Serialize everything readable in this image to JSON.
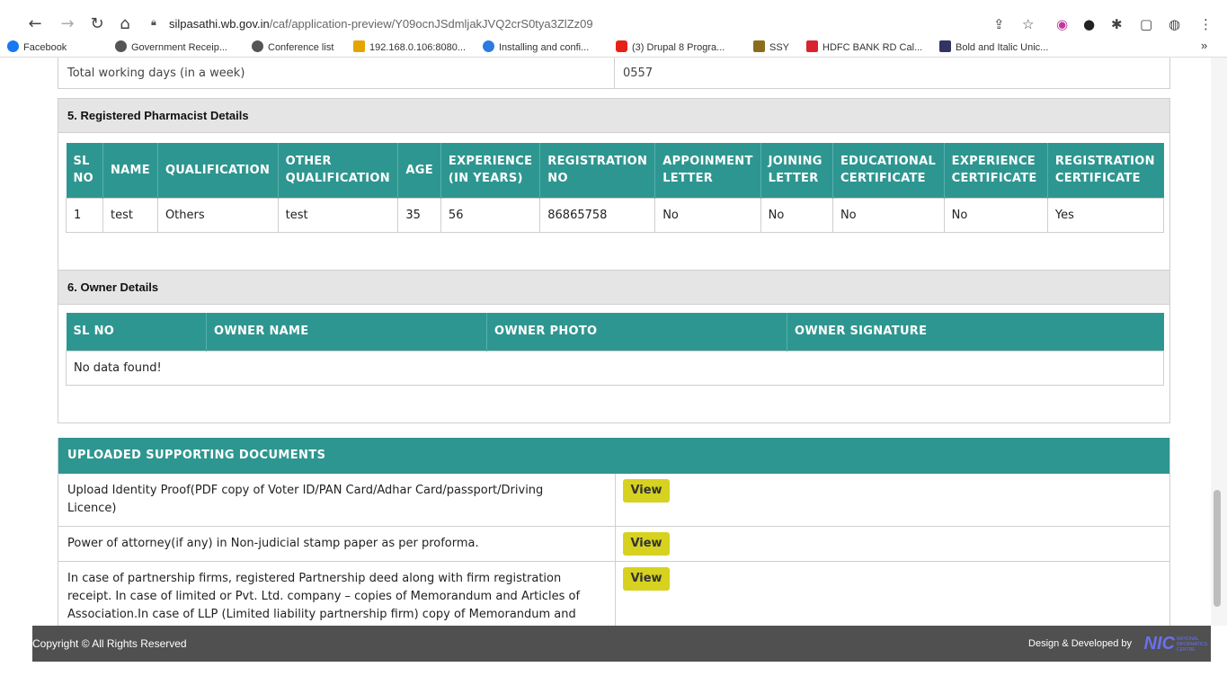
{
  "browser": {
    "url_host": "silpasathi.wb.gov.in",
    "url_path": "/caf/application-preview/Y09ocnJSdmljakJVQ2crS0tya3ZlZz09",
    "bookmarks": [
      {
        "label": "Facebook",
        "color": "#1877f2"
      },
      {
        "label": "Government Receip...",
        "color": "#555555"
      },
      {
        "label": "Conference list",
        "color": "#555555"
      },
      {
        "label": "192.168.0.106:8080...",
        "color": "#e6a400"
      },
      {
        "label": "Installing and confi...",
        "color": "#2a7ae2"
      },
      {
        "label": "(3) Drupal 8 Progra...",
        "color": "#e62117"
      },
      {
        "label": "SSY",
        "color": "#8a6d1b"
      },
      {
        "label": "HDFC BANK RD Cal...",
        "color": "#d9232e"
      },
      {
        "label": "Bold and Italic Unic...",
        "color": "#333366"
      }
    ],
    "more": "»"
  },
  "prev_row": {
    "label": "Total working days (in a week)",
    "value": "0557"
  },
  "pharmacist": {
    "title": "5. Registered Pharmacist Details",
    "headers": [
      "SL NO",
      "NAME",
      "QUALIFICATION",
      "OTHER QUALIFICATION",
      "AGE",
      "EXPERIENCE (IN YEARS)",
      "REGISTRATION NO",
      "APPOINMENT LETTER",
      "JOINING LETTER",
      "EDUCATIONAL CERTIFICATE",
      "EXPERIENCE CERTIFICATE",
      "REGISTRATION CERTIFICATE"
    ],
    "rows": [
      [
        "1",
        "test",
        "Others",
        "test",
        "35",
        "56",
        "86865758",
        "No",
        "No",
        "No",
        "No",
        "Yes"
      ]
    ]
  },
  "owner": {
    "title": "6. Owner Details",
    "headers": [
      "SL NO",
      "OWNER NAME",
      "OWNER PHOTO",
      "OWNER SIGNATURE"
    ],
    "empty": "No data found!"
  },
  "docs": {
    "title": "UPLOADED SUPPORTING DOCUMENTS",
    "items": [
      {
        "text": "Upload Identity Proof(PDF copy of Voter ID/PAN Card/Adhar Card/passport/Driving Licence)",
        "button": "View"
      },
      {
        "text": "Power of attorney(if any) in Non-judicial stamp paper as per proforma.",
        "button": "View"
      },
      {
        "text": "In case of partnership firms, registered Partnership deed along with firm registration receipt. In case of limited or Pvt. Ltd. company – copies of Memorandum and Articles of Association.In case of LLP (Limited liability partnership firm) copy of Memorandum and",
        "button": "View"
      }
    ]
  },
  "footer": {
    "copyright": "Copyright © All Rights Reserved",
    "credit": "Design & Developed by",
    "logo": "NIC",
    "logo_sub": "NATIONAL INFORMATICS CENTRE"
  }
}
